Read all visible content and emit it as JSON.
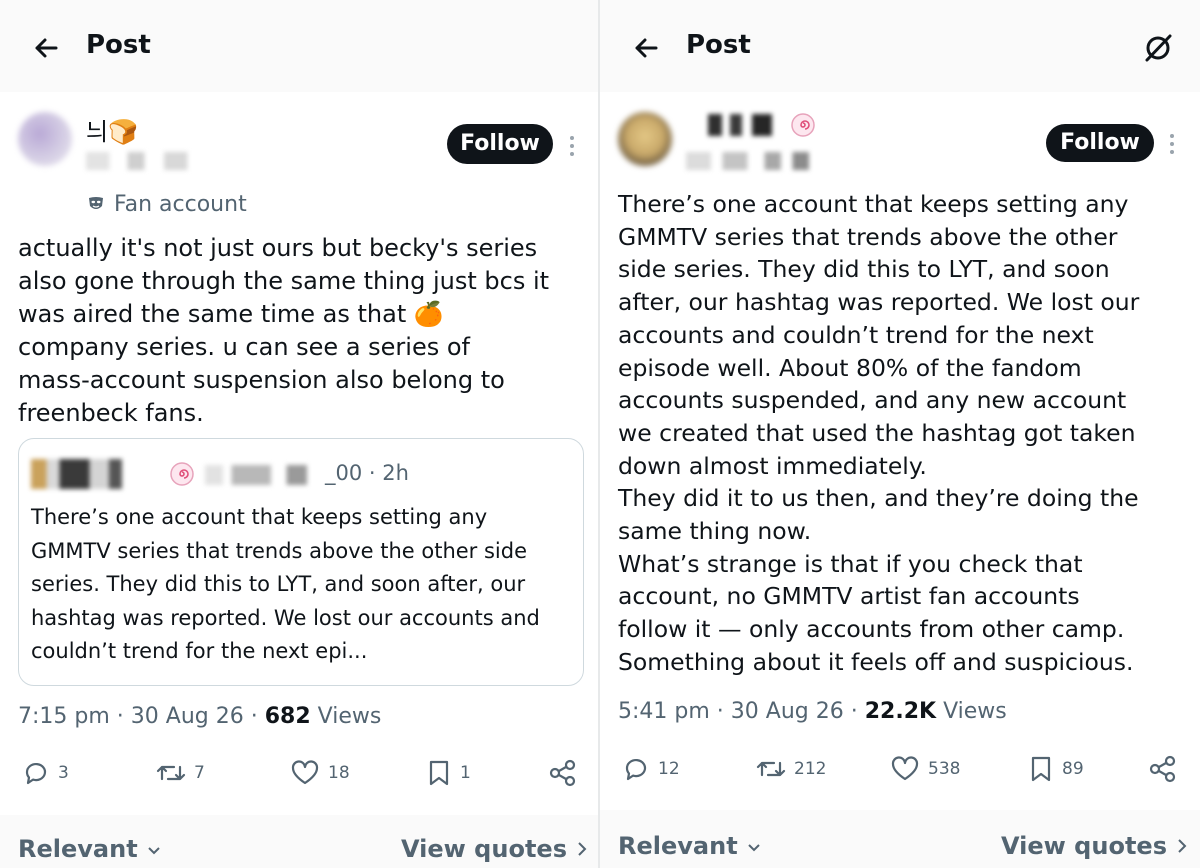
{
  "left": {
    "header": {
      "title": "Post"
    },
    "author": {
      "display_name": "늬🍞",
      "badge": "Fan account",
      "follow_label": "Follow"
    },
    "post": {
      "text": "actually it's not just ours but becky's series\nalso gone through the same thing just bcs it\nwas aired the same time as that 🍊\ncompany series. u can see a series of\nmass-account suspension also belong to\nfreenbeck fans."
    },
    "quote": {
      "handle_tail": "_00",
      "time": "· 2h",
      "text": "There’s one account that keeps setting any GMMTV series that trends above the other side series. They did this to LYT, and soon after, our hashtag was reported. We lost our accounts and couldn’t trend for the next epi..."
    },
    "meta": {
      "time": "7:15 pm",
      "sep": "·",
      "date": "30 Aug 26",
      "views_count": "682",
      "views_label": "Views"
    },
    "actions": {
      "replies": "3",
      "reposts": "7",
      "likes": "18",
      "bookmarks": "1"
    },
    "footer": {
      "relevant": "Relevant",
      "view_quotes": "View quotes"
    }
  },
  "right": {
    "header": {
      "title": "Post"
    },
    "author": {
      "follow_label": "Follow"
    },
    "post": {
      "text": "There’s one account that keeps setting any\nGMMTV series that trends above the other\nside series. They did this to LYT, and soon\nafter, our hashtag was reported. We lost our\naccounts and couldn’t trend for the next\nepisode well. About 80% of the fandom\naccounts suspended, and any new account\nwe created that used the hashtag got taken\ndown almost immediately.\nThey did it to us then, and they’re doing the\nsame thing now.\nWhat’s strange is that if you check that\naccount, no GMMTV artist fan accounts\nfollow it — only accounts from other camp.\nSomething about it feels off and suspicious."
    },
    "meta": {
      "time": "5:41 pm",
      "sep": "·",
      "date": "30 Aug 26",
      "views_count": "22.2K",
      "views_label": "Views"
    },
    "actions": {
      "replies": "12",
      "reposts": "212",
      "likes": "538",
      "bookmarks": "89"
    },
    "footer": {
      "relevant": "Relevant",
      "view_quotes": "View quotes"
    }
  },
  "icons": [
    "back-arrow-icon",
    "grok-icon",
    "more-icon",
    "mask-icon",
    "reply-icon",
    "repost-icon",
    "like-icon",
    "bookmark-icon",
    "share-icon",
    "chevron-down-icon",
    "chevron-right-icon",
    "naruto-swirl-icon"
  ]
}
